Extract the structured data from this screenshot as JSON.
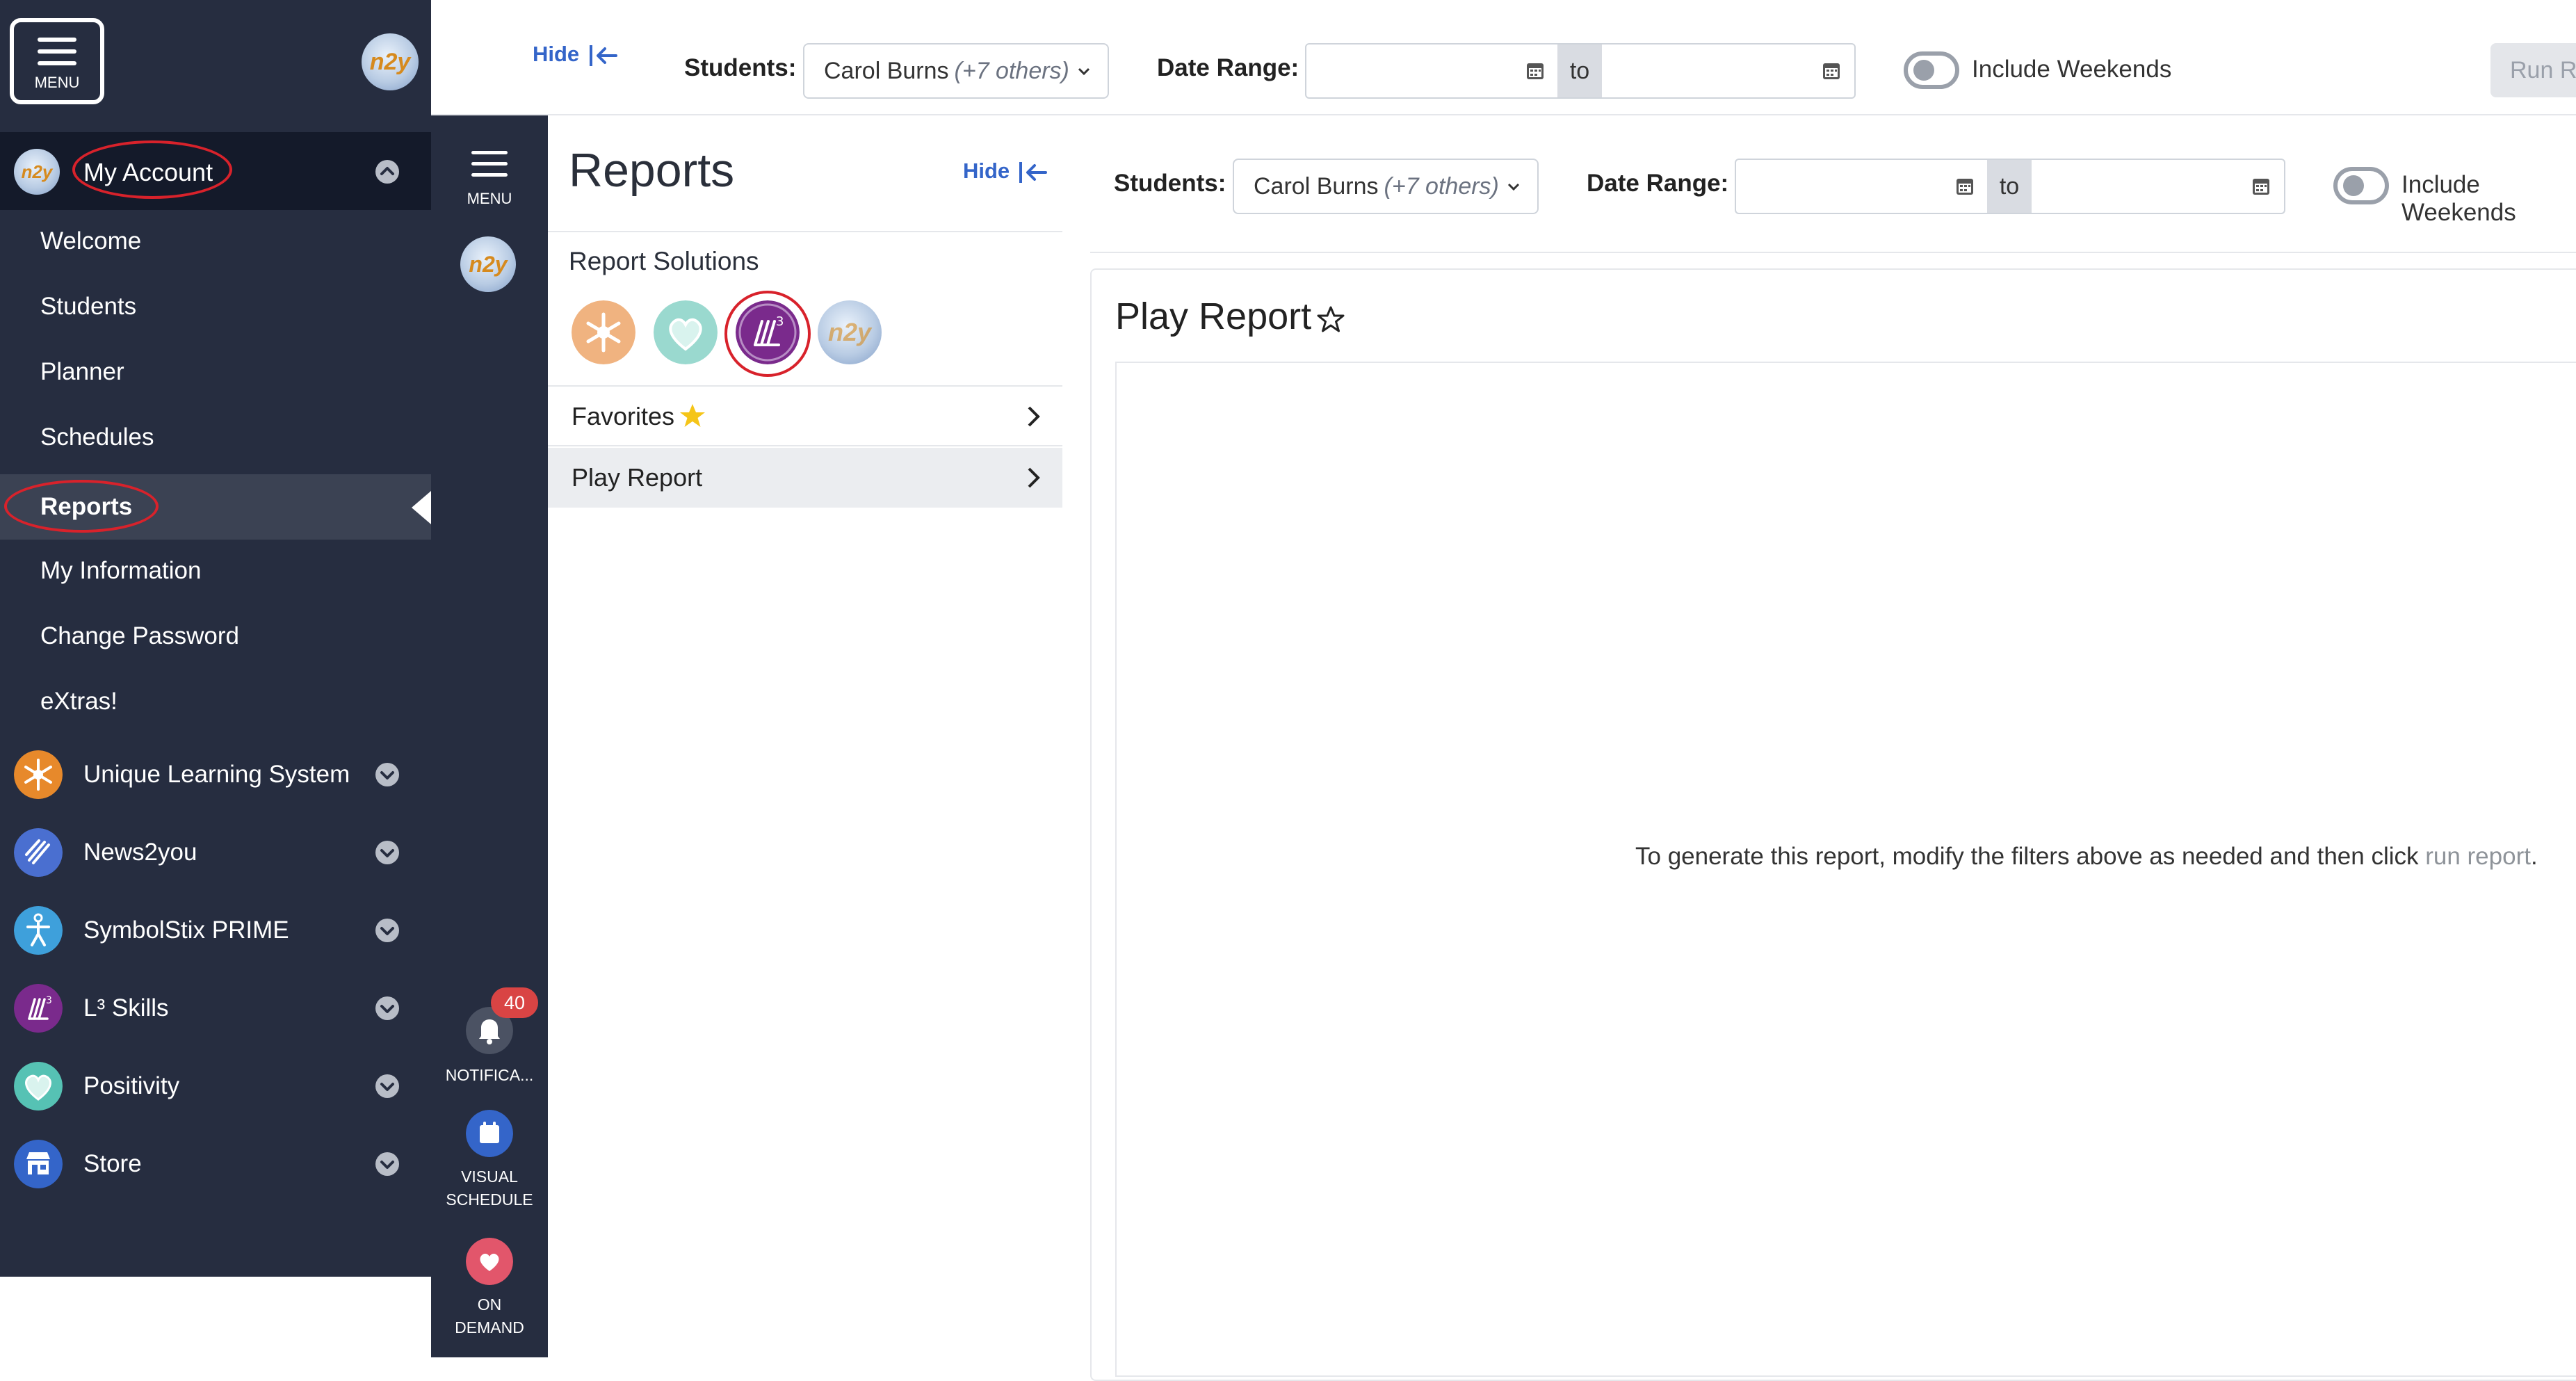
{
  "drawer": {
    "menu_label": "MENU",
    "account_label": "My Account",
    "avatar_text": "n2y",
    "sub_items": [
      "Welcome",
      "Students",
      "Planner",
      "Schedules",
      "Reports",
      "My Information",
      "Change Password",
      "eXtras!"
    ],
    "apps": [
      {
        "label": "Unique Learning System",
        "color": "#e7892b"
      },
      {
        "label": "News2you",
        "color": "#4a6fd0"
      },
      {
        "label": "SymbolStix PRIME",
        "color": "#3ea0db"
      },
      {
        "label": "L³ Skills",
        "color": "#7a2a8c"
      },
      {
        "label": "Positivity",
        "color": "#56c2b4"
      },
      {
        "label": "Store",
        "color": "#3465c9"
      }
    ]
  },
  "filters": {
    "hide_label": "Hide",
    "students_label": "Students:",
    "students_value": "Carol Burns",
    "students_extra": "(+7 others)",
    "date_range_label": "Date Range:",
    "date_from": "",
    "date_to": "",
    "to_label": "to",
    "weekends_label": "Include Weekends",
    "weekends_label_cut": "Include Weekends",
    "run_label": "Run Re"
  },
  "rail": {
    "menu_label": "MENU",
    "notifications_label": "NOTIFICA...",
    "notifications_count": "40",
    "visual_line1": "VISUAL",
    "visual_line2": "SCHEDULE",
    "ondemand_line1": "ON",
    "ondemand_line2": "DEMAND"
  },
  "panel": {
    "title": "Reports",
    "hide_label": "Hide",
    "solutions_label": "Report Solutions",
    "favorites_label": "Favorites",
    "play_report_label": "Play Report"
  },
  "report": {
    "title": "Play Report",
    "message_prefix": "To generate this report, modify the filters above as needed and then click ",
    "message_link": "run report",
    "message_suffix": "."
  },
  "colors": {
    "drawer_bg": "#262d40",
    "accent_blue": "#3465c9",
    "highlight_red": "#d8222b",
    "favorite_star": "#f5c518"
  }
}
